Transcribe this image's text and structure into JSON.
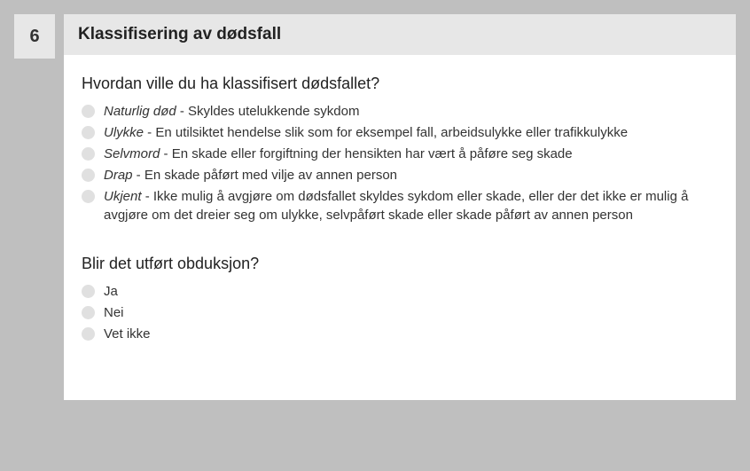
{
  "step": "6",
  "title": "Klassifisering av dødsfall",
  "q1": {
    "prompt": "Hvordan ville du ha klassifisert dødsfallet?",
    "options": [
      {
        "term": "Naturlig død",
        "desc": " - Skyldes utelukkende sykdom"
      },
      {
        "term": "Ulykke",
        "desc": " - En utilsiktet hendelse slik som for eksempel fall, arbeidsulykke eller trafikkulykke"
      },
      {
        "term": "Selvmord",
        "desc": " - En skade eller forgiftning der hensikten har vært å påføre seg skade"
      },
      {
        "term": "Drap",
        "desc": " - En skade påført med vilje av annen person"
      },
      {
        "term": "Ukjent",
        "desc": " - Ikke mulig å avgjøre om dødsfallet skyldes sykdom eller skade, eller der det ikke er mulig å avgjøre om det dreier seg om ulykke, selvpåført skade eller skade påført av annen person"
      }
    ]
  },
  "q2": {
    "prompt": "Blir det utført obduksjon?",
    "options": [
      {
        "label": "Ja"
      },
      {
        "label": "Nei"
      },
      {
        "label": "Vet ikke"
      }
    ]
  }
}
